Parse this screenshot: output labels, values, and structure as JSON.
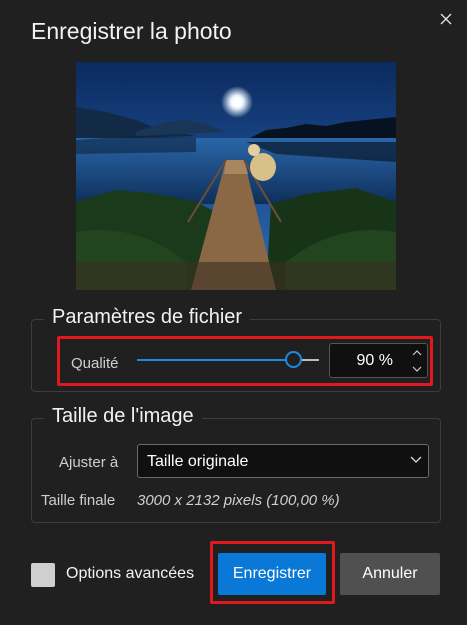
{
  "dialog": {
    "title": "Enregistrer la photo"
  },
  "preview": {
    "description_icon": "image-preview"
  },
  "file_params": {
    "legend": "Paramètres de fichier",
    "quality_label": "Qualité",
    "quality_value": "90 %",
    "quality_percent": 90
  },
  "image_size": {
    "legend": "Taille de l'image",
    "adjust_label": "Ajuster à",
    "adjust_value": "Taille originale",
    "final_label": "Taille finale",
    "final_value": "3000 x 2132 pixels (100,00 %)"
  },
  "footer": {
    "advanced_label": "Options avancées",
    "save_label": "Enregistrer",
    "cancel_label": "Annuler"
  },
  "colors": {
    "accent": "#0a78d7",
    "highlight": "#e0191f",
    "background": "#202020"
  }
}
